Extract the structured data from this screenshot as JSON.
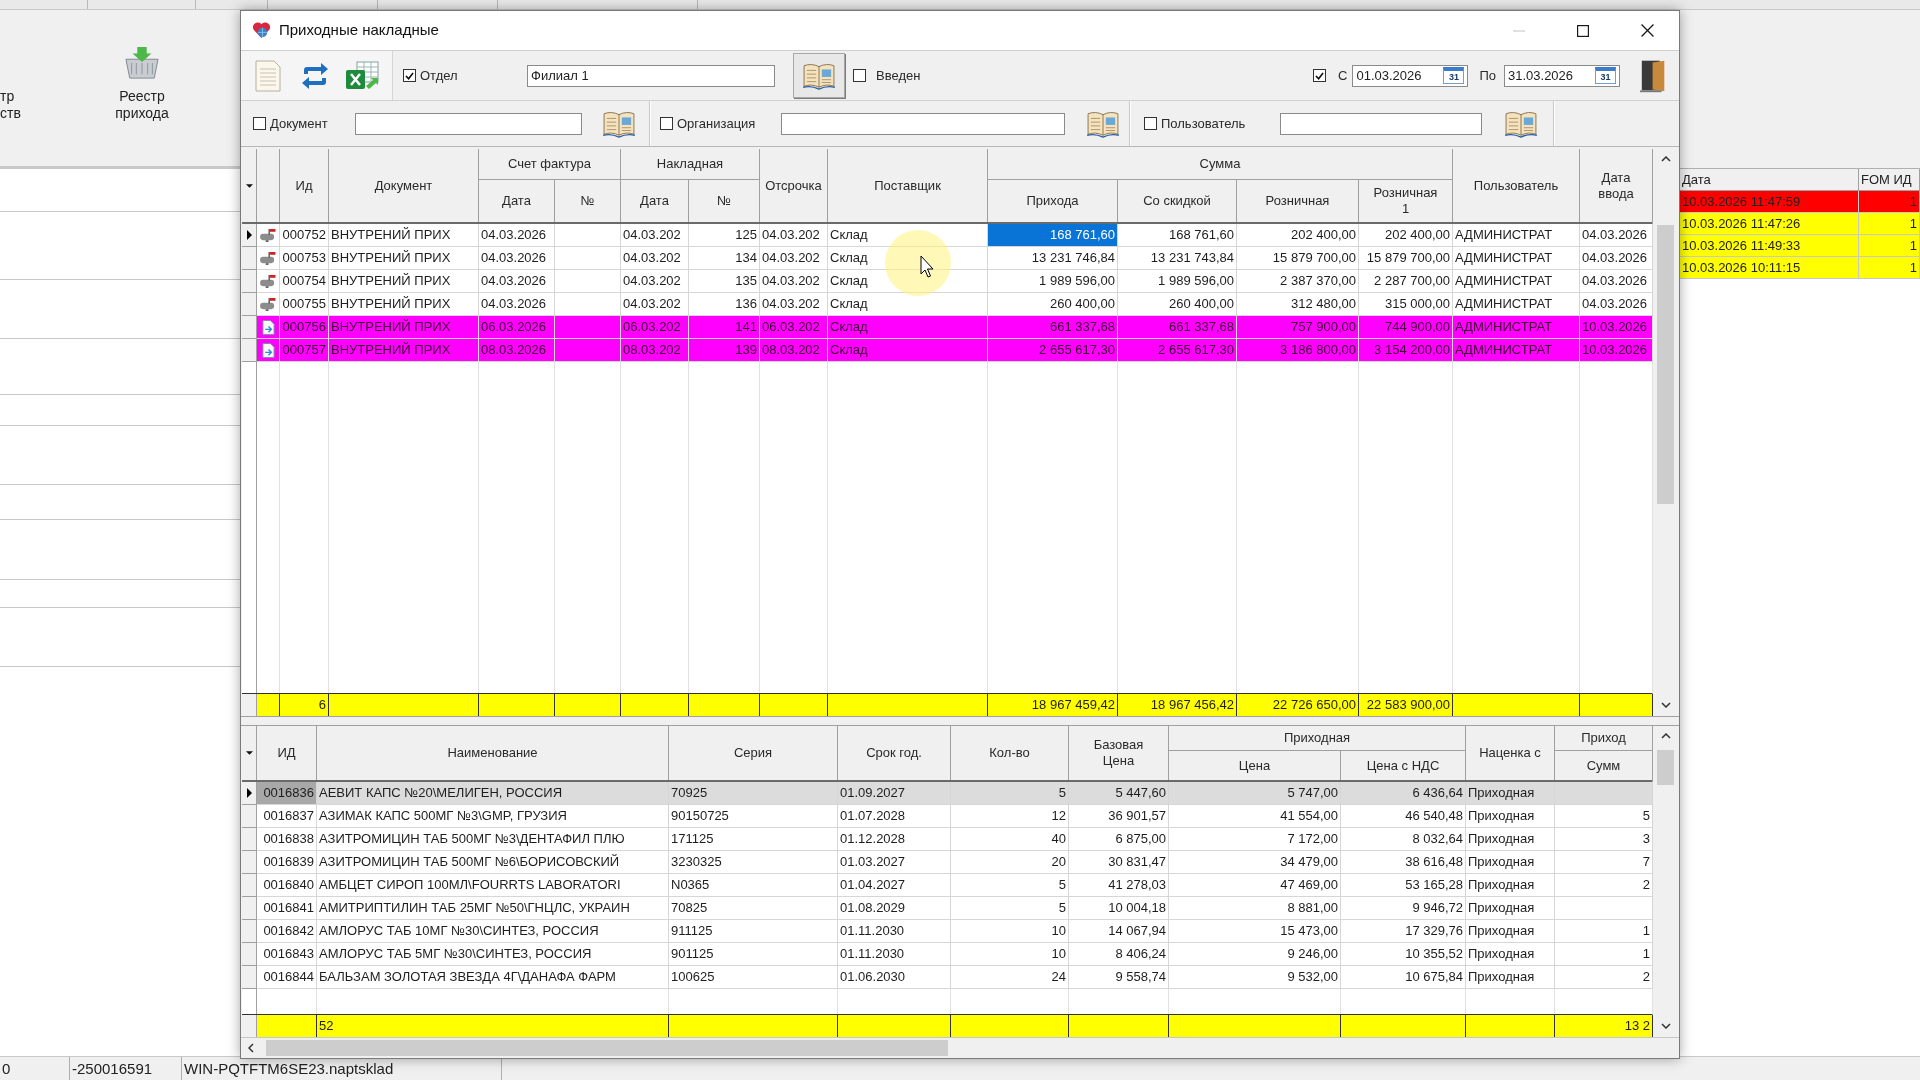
{
  "desktop": {
    "toolbar": [
      {
        "kind": "text",
        "label": "тр ств"
      },
      {
        "kind": "basket",
        "label": "Реестр прихода"
      }
    ],
    "side_table": {
      "columns": [
        "Дата",
        "FOM ИД"
      ],
      "rows": [
        {
          "color": "#ff0000",
          "cells": [
            "10.03.2026 11:47:59",
            "1"
          ]
        },
        {
          "color": "#ffff00",
          "cells": [
            "10.03.2026 11:47:26",
            "1"
          ]
        },
        {
          "color": "#ffff00",
          "cells": [
            "10.03.2026 11:49:33",
            "1"
          ]
        },
        {
          "color": "#ffff00",
          "cells": [
            "10.03.2026 10:11:15",
            "1"
          ]
        }
      ]
    },
    "status_bar": [
      "0",
      "-250016591",
      "WIN-PQTFTM6SE23.naptsklad"
    ]
  },
  "window": {
    "title": "Приходные накладные",
    "controls": [
      {
        "kind": "minimize",
        "disabled": true
      },
      {
        "kind": "maximize",
        "disabled": false
      },
      {
        "kind": "close",
        "disabled": false
      }
    ]
  },
  "filters": {
    "department": {
      "label": "Отдел",
      "checked": true,
      "value": "Филиал 1"
    },
    "entered": {
      "label": "Введен",
      "checked": false
    },
    "date_from": {
      "label": "С",
      "checked": true,
      "value": "01.03.2026",
      "calendar": "31"
    },
    "date_to": {
      "label": "По",
      "value": "31.03.2026",
      "calendar": "31"
    },
    "document": {
      "label": "Документ",
      "checked": false
    },
    "organization": {
      "label": "Организация",
      "checked": false
    },
    "user": {
      "label": "Пользователь",
      "checked": false
    }
  },
  "invoices": {
    "header": [
      {
        "label": "Ид",
        "current": false
      },
      {
        "label": "Документ",
        "current": false
      },
      {
        "group": "Счет фактура",
        "columns": [
          {
            "label": "Дата",
            "current": false
          },
          {
            "label": "№",
            "current": false
          }
        ]
      },
      {
        "group": "Накладная",
        "columns": [
          {
            "label": "Дата",
            "current": false
          },
          {
            "label": "№",
            "current": false
          }
        ]
      },
      {
        "label": "Отсрочка",
        "current": false
      },
      {
        "label": "Поставщик",
        "current": false
      },
      {
        "group": "Сумма",
        "columns": [
          {
            "label": "Прихода",
            "current": true
          },
          {
            "label": "Со скидкой",
            "current": false
          },
          {
            "label": "Розничная",
            "current": false
          },
          {
            "label": "Розничная 1",
            "current": false
          }
        ]
      },
      {
        "label": "Пользователь",
        "current": false
      },
      {
        "label": "Дата ввода",
        "current": false
      }
    ],
    "rows": [
      {
        "selected": true,
        "kind": "mailbox",
        "color": "#ffffff",
        "cells": {
          "id": "000752",
          "document": "ВНУТРЕНИЙ ПРИХ",
          "invoice_date": "04.03.2026",
          "waybill_date": "04.03.202",
          "waybill_no": "125",
          "deferral": "04.03.202",
          "supplier": "Склад",
          "incoming": "168 761,60",
          "discounted": "168 761,60",
          "retail": "202 400,00",
          "retail_1": "202 400,00",
          "user": "АДМИНИСТРАТ",
          "entry_date": "04.03.2026"
        }
      },
      {
        "selected": false,
        "kind": "mailbox",
        "color": "#ffffff",
        "cells": {
          "id": "000753",
          "document": "ВНУТРЕНИЙ ПРИХ",
          "invoice_date": "04.03.2026",
          "waybill_date": "04.03.202",
          "waybill_no": "134",
          "deferral": "04.03.202",
          "supplier": "Склад",
          "incoming": "13 231 746,84",
          "discounted": "13 231 743,84",
          "retail": "15 879 700,00",
          "retail_1": "15 879 700,00",
          "user": "АДМИНИСТРАТ",
          "entry_date": "04.03.2026"
        }
      },
      {
        "selected": false,
        "kind": "mailbox",
        "color": "#ffffff",
        "cells": {
          "id": "000754",
          "document": "ВНУТРЕНИЙ ПРИХ",
          "invoice_date": "04.03.2026",
          "waybill_date": "04.03.202",
          "waybill_no": "135",
          "deferral": "04.03.202",
          "supplier": "Склад",
          "incoming": "1 989 596,00",
          "discounted": "1 989 596,00",
          "retail": "2 387 370,00",
          "retail_1": "2 287 700,00",
          "user": "АДМИНИСТРАТ",
          "entry_date": "04.03.2026"
        }
      },
      {
        "selected": false,
        "kind": "mailbox",
        "color": "#ffffff",
        "cells": {
          "id": "000755",
          "document": "ВНУТРЕНИЙ ПРИХ",
          "invoice_date": "04.03.2026",
          "waybill_date": "04.03.202",
          "waybill_no": "136",
          "deferral": "04.03.202",
          "supplier": "Склад",
          "incoming": "260 400,00",
          "discounted": "260 400,00",
          "retail": "312 480,00",
          "retail_1": "315 000,00",
          "user": "АДМИНИСТРАТ",
          "entry_date": "04.03.2026"
        }
      },
      {
        "selected": false,
        "kind": "document",
        "color": "#ff00ff",
        "cells": {
          "id": "000756",
          "document": "ВНУТРЕНИЙ ПРИХ",
          "invoice_date": "06.03.2026",
          "waybill_date": "06.03.202",
          "waybill_no": "141",
          "deferral": "06.03.202",
          "supplier": "Склад",
          "incoming": "661 337,68",
          "discounted": "661 337,68",
          "retail": "757 900,00",
          "retail_1": "744 900,00",
          "user": "АДМИНИСТРАТ",
          "entry_date": "10.03.2026"
        }
      },
      {
        "selected": false,
        "kind": "document",
        "color": "#ff00ff",
        "cells": {
          "id": "000757",
          "document": "ВНУТРЕНИЙ ПРИХ",
          "invoice_date": "08.03.2026",
          "waybill_date": "08.03.202",
          "waybill_no": "139",
          "deferral": "08.03.202",
          "supplier": "Склад",
          "incoming": "2 655 617,30",
          "discounted": "2 655 617,30",
          "retail": "3 186 800,00",
          "retail_1": "3 154 200,00",
          "user": "АДМИНИСТРАТ",
          "entry_date": "10.03.2026"
        }
      }
    ],
    "totals": {
      "id": "6",
      "incoming": "18 967 459,42",
      "discounted": "18 967 456,42",
      "retail": "22 726 650,00",
      "retail_1": "22 583 900,00"
    }
  },
  "items": {
    "header": [
      {
        "label": "ИД",
        "current": true
      },
      {
        "label": "Наименование",
        "current": false
      },
      {
        "label": "Серия",
        "current": false
      },
      {
        "label": "Срок год.",
        "current": false
      },
      {
        "label": "Кол-во",
        "current": false
      },
      {
        "label": "Базовая Цена",
        "current": false
      },
      {
        "group": "Приходная",
        "columns": [
          {
            "label": "Цена",
            "current": false
          },
          {
            "label": "Цена с НДС",
            "current": false
          }
        ]
      },
      {
        "label": "Наценка с",
        "current": false
      },
      {
        "group": "Приход",
        "columns": [
          {
            "label": "Сумм",
            "current": false
          }
        ]
      }
    ],
    "rows": [
      {
        "selected": true,
        "cells": {
          "id": "0016836",
          "name": "АЕВИТ КАПС №20\\МЕЛИГЕН, РОССИЯ",
          "series": "70925",
          "expiry": "01.09.2027",
          "qty": "5",
          "base_price": "5 447,60",
          "price": "5 747,00",
          "price_vat": "6 436,64",
          "markup": "Приходная"
        }
      },
      {
        "selected": false,
        "cells": {
          "id": "0016837",
          "name": "АЗИМАК КАПС 500МГ №3\\GMP, ГРУЗИЯ",
          "series": "90150725",
          "expiry": "01.07.2028",
          "qty": "12",
          "base_price": "36 901,57",
          "price": "41 554,00",
          "price_vat": "46 540,48",
          "markup": "Приходная",
          "incoming_sum": "5"
        }
      },
      {
        "selected": false,
        "cells": {
          "id": "0016838",
          "name": "АЗИТРОМИЦИН ТАБ 500МГ №3\\ДЕНТАФИЛ ПЛЮ",
          "series": "171125",
          "expiry": "01.12.2028",
          "qty": "40",
          "base_price": "6 875,00",
          "price": "7 172,00",
          "price_vat": "8 032,64",
          "markup": "Приходная",
          "incoming_sum": "3"
        }
      },
      {
        "selected": false,
        "cells": {
          "id": "0016839",
          "name": "АЗИТРОМИЦИН ТАБ 500МГ №6\\БОРИСОВСКИЙ",
          "series": "3230325",
          "expiry": "01.03.2027",
          "qty": "20",
          "base_price": "30 831,47",
          "price": "34 479,00",
          "price_vat": "38 616,48",
          "markup": "Приходная",
          "incoming_sum": "7"
        }
      },
      {
        "selected": false,
        "cells": {
          "id": "0016840",
          "name": "АМБЦЕТ СИРОП 100МЛ\\FOURRTS LABORATORI",
          "series": "N0365",
          "expiry": "01.04.2027",
          "qty": "5",
          "base_price": "41 278,03",
          "price": "47 469,00",
          "price_vat": "53 165,28",
          "markup": "Приходная",
          "incoming_sum": "2"
        }
      },
      {
        "selected": false,
        "cells": {
          "id": "0016841",
          "name": "АМИТРИПТИЛИН ТАБ 25МГ №50\\ГНЦЛС, УКРАИН",
          "series": "70825",
          "expiry": "01.08.2029",
          "qty": "5",
          "base_price": "10 004,18",
          "price": "8 881,00",
          "price_vat": "9 946,72",
          "markup": "Приходная"
        }
      },
      {
        "selected": false,
        "cells": {
          "id": "0016842",
          "name": "АМЛОРУС ТАБ 10МГ №30\\СИНТЕЗ, РОССИЯ",
          "series": "911125",
          "expiry": "01.11.2030",
          "qty": "10",
          "base_price": "14 067,94",
          "price": "15 473,00",
          "price_vat": "17 329,76",
          "markup": "Приходная",
          "incoming_sum": "1"
        }
      },
      {
        "selected": false,
        "cells": {
          "id": "0016843",
          "name": "АМЛОРУС ТАБ 5МГ №30\\СИНТЕЗ, РОССИЯ",
          "series": "901125",
          "expiry": "01.11.2030",
          "qty": "10",
          "base_price": "8 406,24",
          "price": "9 246,00",
          "price_vat": "10 355,52",
          "markup": "Приходная",
          "incoming_sum": "1"
        }
      },
      {
        "selected": false,
        "cells": {
          "id": "0016844",
          "name": "БАЛЬЗАМ ЗОЛОТАЯ ЗВЕЗДА 4Г\\ДАНАФА ФАРМ",
          "series": "100625",
          "expiry": "01.06.2030",
          "qty": "24",
          "base_price": "9 558,74",
          "price": "9 532,00",
          "price_vat": "10 675,84",
          "markup": "Приходная",
          "incoming_sum": "2"
        }
      }
    ],
    "totals": {
      "name": "52",
      "incoming_sum": "13 2"
    }
  }
}
